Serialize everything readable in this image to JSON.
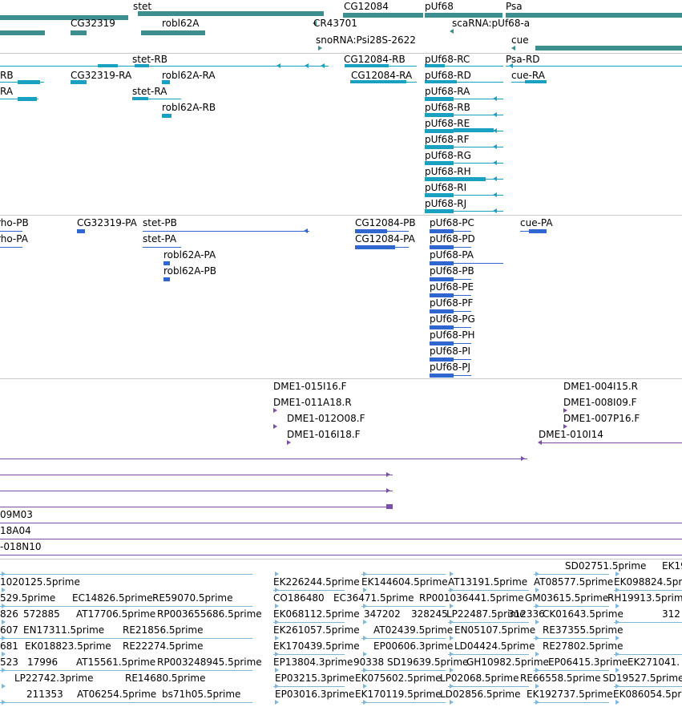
{
  "colors": {
    "gene": "#3d8f8f",
    "transcript": "#1aa0c0",
    "protein": "#2f66d0",
    "clone": "#7a4fa6",
    "est": "#7fb7dc",
    "separator": "#c8c8c8"
  },
  "tracks": {
    "gene_labels": [
      "stet",
      "CG12084",
      "pUf68",
      "Psa",
      "CG32319",
      "robl62A",
      "CR43701",
      "scaRNA:pUf68-a",
      "snoRNA:Psi28S-2622",
      "cue"
    ],
    "transcript_labels": [
      "stet-RB",
      "CG12084-RB",
      "pUf68-RC",
      "Psa-RD",
      "RB",
      "CG32319-RA",
      "robl62A-RA",
      "CG12084-RA",
      "pUf68-RD",
      "cue-RA",
      "RA",
      "stet-RA",
      "pUf68-RA",
      "robl62A-RB",
      "pUf68-RB",
      "pUf68-RE",
      "pUf68-RF",
      "pUf68-RG",
      "pUf68-RH",
      "pUf68-RI",
      "pUf68-RJ"
    ],
    "protein_labels": [
      "rho-PB",
      "CG32319-PA",
      "stet-PB",
      "CG12084-PB",
      "pUf68-PC",
      "cue-PA",
      "rho-PA",
      "stet-PA",
      "CG12084-PA",
      "pUf68-PD",
      "robl62A-PA",
      "pUf68-PA",
      "robl62A-PB",
      "pUf68-PB",
      "pUf68-PE",
      "pUf68-PF",
      "pUf68-PG",
      "pUf68-PH",
      "pUf68-PI",
      "pUf68-PJ"
    ],
    "clone_labels": [
      "DME1-015I16.F",
      "DME1-004I15.R",
      "DME1-011A18.R",
      "DME1-008I09.F",
      "DME1-012O08.F",
      "DME1-007P16.F",
      "DME1-016I18.F",
      "DME1-010I14",
      "09M03",
      "18A04",
      "-018N10"
    ],
    "est_labels": [
      "SD02751.5prime",
      "EK19",
      "1020125.5prime",
      "EK226244.5prime",
      "EK144604.5prime",
      "AT13191.5prime",
      "AT08577.5prime",
      "EK098824.5prime",
      "529.5prime",
      "EC14826.5prime",
      "RE59070.5prime",
      "CO186480",
      "EC36471.5prime",
      "RP001036441.5prime",
      "GM03615.5prime",
      "RH19913.5prime",
      "826",
      "572885",
      "AT17706.5prime",
      "RP003655686.5prime",
      "EK068112.5prime",
      "347202",
      "328245",
      "LP22487.5prime",
      "312336",
      "CK01643.5prime",
      "312",
      "607",
      "EN17311.5prime",
      "RE21856.5prime",
      "EK261057.5prime",
      "AT02439.5prime",
      "EN05107.5prime",
      "RE37355.5prime",
      "681",
      "EK018823.5prime",
      "RE22274.5prime",
      "EK170439.5prime",
      "EP00606.3prime",
      "LD04424.5prime",
      "RE27802.5prime",
      "523",
      "17996",
      "AT15561.5prime",
      "RP003248945.5prime",
      "EP13804.3prime",
      "90338",
      "SD19639.5prime",
      "GH10982.5prime",
      "EP06415.3prime",
      "EK271041.",
      "LP22742.3prime",
      "RE14680.5prime",
      "EP03215.3prime",
      "EK075602.5prime",
      "LP02068.5prime",
      "RE66558.5prime",
      "SD19527.5prime",
      "211353",
      "AT06254.5prime",
      "bs71h05.5prime",
      "EP03016.3prime",
      "EK170119.5prime",
      "LD02856.5prime",
      "EK192737.5prime",
      "EK086054.5prime"
    ]
  }
}
